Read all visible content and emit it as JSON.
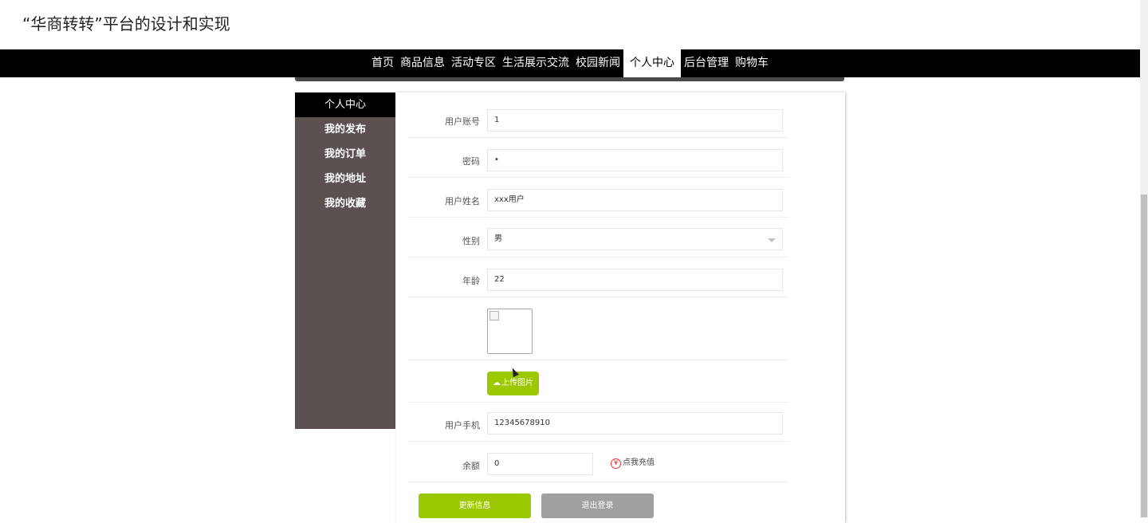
{
  "site": {
    "title": "“华商转转”平台的设计和实现"
  },
  "nav": {
    "items": [
      {
        "label": "首页"
      },
      {
        "label": "商品信息"
      },
      {
        "label": "活动专区"
      },
      {
        "label": "生活展示交流"
      },
      {
        "label": "校园新闻"
      },
      {
        "label": "个人中心",
        "active": true
      },
      {
        "label": "后台管理"
      },
      {
        "label": "购物车"
      }
    ]
  },
  "sidebar": {
    "items": [
      {
        "label": "个人中心",
        "active": true
      },
      {
        "label": "我的发布"
      },
      {
        "label": "我的订单"
      },
      {
        "label": "我的地址"
      },
      {
        "label": "我的收藏"
      }
    ]
  },
  "form": {
    "account": {
      "label": "用户账号",
      "value": "1"
    },
    "password": {
      "label": "密码",
      "value": "•"
    },
    "name": {
      "label": "用户姓名",
      "value": "xxx用户"
    },
    "gender": {
      "label": "性别",
      "value": "男"
    },
    "age": {
      "label": "年龄",
      "value": "22"
    },
    "upload_label": "上传图片",
    "phone": {
      "label": "用户手机",
      "value": "12345678910"
    },
    "balance": {
      "label": "余额",
      "value": "0",
      "recharge_label": "点我充值",
      "yen": "¥"
    }
  },
  "buttons": {
    "update": "更新信息",
    "logout": "退出登录"
  },
  "colors": {
    "accent": "#9cc800",
    "nav_bg": "#000000",
    "sidebar_bg": "#5a5150",
    "logout_bg": "#a0a0a0"
  }
}
